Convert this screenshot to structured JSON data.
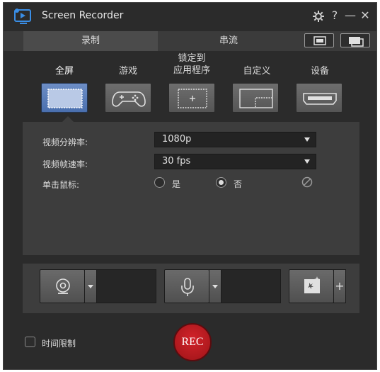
{
  "app": {
    "title": "Screen Recorder"
  },
  "titlebar": {
    "help_label": "?",
    "minimize_label": "—",
    "close_label": "✕"
  },
  "tabs": [
    {
      "label": "录制",
      "active": true
    },
    {
      "label": "串流",
      "active": false
    }
  ],
  "modes": [
    {
      "label": "全屏",
      "icon": "fullscreen-icon",
      "active": true
    },
    {
      "label": "游戏",
      "icon": "gamepad-icon",
      "active": false
    },
    {
      "label": "锁定到\n应用程序",
      "icon": "lock-to-app-icon",
      "active": false
    },
    {
      "label": "自定义",
      "icon": "custom-region-icon",
      "active": false
    },
    {
      "label": "设备",
      "icon": "hdmi-device-icon",
      "active": false
    }
  ],
  "settings": {
    "resolution": {
      "label": "视频分辨率:",
      "value": "1080p"
    },
    "framerate": {
      "label": "视频帧速率:",
      "value": "30 fps"
    },
    "mouse_click": {
      "label": "单击鼠标:",
      "options": [
        "是",
        "否"
      ],
      "selected": "否"
    }
  },
  "footer": {
    "time_limit_label": "时间限制",
    "rec_label": "REC"
  },
  "colors": {
    "accent": "#4a6fae",
    "rec": "#c41e24",
    "background": "#2b2b2b",
    "panel": "#3d3d3d"
  }
}
